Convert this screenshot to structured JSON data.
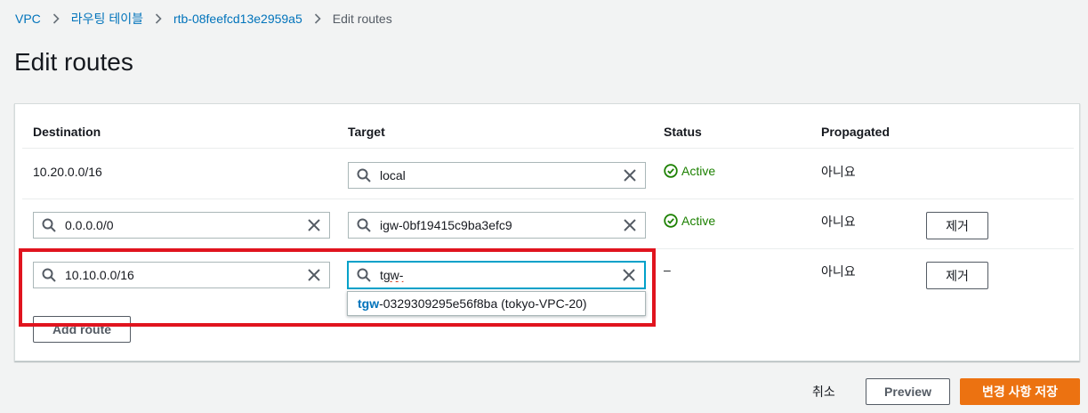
{
  "breadcrumb": {
    "items": [
      "VPC",
      "라우팅 테이블",
      "rtb-08feefcd13e2959a5"
    ],
    "current": "Edit routes"
  },
  "page": {
    "title": "Edit routes"
  },
  "table": {
    "headers": {
      "destination": "Destination",
      "target": "Target",
      "status": "Status",
      "propagated": "Propagated"
    },
    "rows": [
      {
        "destination": "10.20.0.0/16",
        "target": "local",
        "status": "Active",
        "propagated": "아니요"
      },
      {
        "destination": "0.0.0.0/0",
        "target": "igw-0bf19415c9ba3efc9",
        "status": "Active",
        "propagated": "아니요",
        "remove_label": "제거"
      },
      {
        "destination": "10.10.0.0/16",
        "target": "tgw-",
        "status": "–",
        "propagated": "아니요",
        "remove_label": "제거"
      }
    ],
    "suggestion": {
      "match": "tgw",
      "rest": "-0329309295e56f8ba (tokyo-VPC-20)"
    },
    "add_route_label": "Add route"
  },
  "footer": {
    "cancel_label": "취소",
    "preview_label": "Preview",
    "save_label": "변경 사항 저장"
  },
  "colors": {
    "link": "#0073bb",
    "active": "#1d8102",
    "primary": "#ec7211",
    "focus": "#00a1c9",
    "annotation": "#e0141e"
  }
}
